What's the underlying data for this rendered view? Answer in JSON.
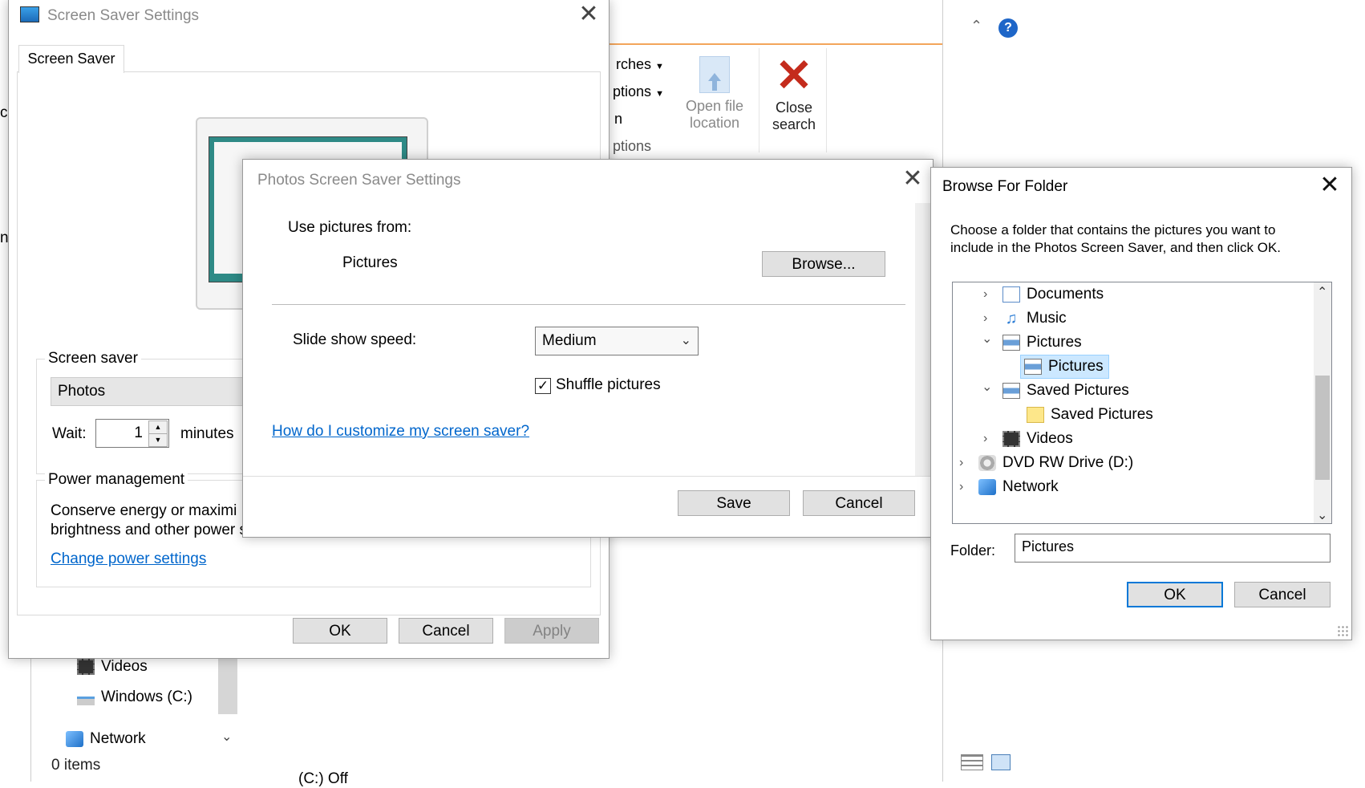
{
  "explorer": {
    "ribbon_partial_items": [
      "rches",
      "ptions",
      "n",
      "ptions"
    ],
    "open_file_location": [
      "Open file",
      "location"
    ],
    "close_search": [
      "Close",
      "search"
    ],
    "nav_items": [
      {
        "label": "Videos"
      },
      {
        "label": "Windows (C:)"
      },
      {
        "label": "Network"
      }
    ],
    "status_items": "0 items",
    "bottom_partial": "(C:)   Off"
  },
  "screensaver_dialog": {
    "title": "Screen Saver Settings",
    "tab": "Screen Saver",
    "group_screensaver_label": "Screen saver",
    "selected_saver": "Photos",
    "wait_label": "Wait:",
    "wait_value": "1",
    "minutes_label": "minutes",
    "power_group_label": "Power management",
    "power_text_line1": "Conserve energy or maximi",
    "power_text_line2": "brightness and other power settings.",
    "change_power_link": "Change power settings",
    "ok": "OK",
    "cancel": "Cancel",
    "apply": "Apply"
  },
  "photos_dialog": {
    "title": "Photos Screen Saver Settings",
    "use_pictures_label": "Use pictures from:",
    "folder_value": "Pictures",
    "browse_button": "Browse...",
    "speed_label": "Slide show speed:",
    "speed_value": "Medium",
    "shuffle_label": "Shuffle pictures",
    "shuffle_checked": true,
    "help_link": "How do I customize my screen saver?",
    "save": "Save",
    "cancel": "Cancel"
  },
  "browse_dialog": {
    "title": "Browse For Folder",
    "instructions_line1": "Choose a folder that contains the pictures you want to",
    "instructions_line2": "include in the Photos Screen Saver, and then click OK.",
    "tree": [
      {
        "label": "Documents",
        "icon": "documents-icon",
        "expander": "collapsed"
      },
      {
        "label": "Music",
        "icon": "music-icon",
        "expander": "collapsed"
      },
      {
        "label": "Pictures",
        "icon": "pictures-icon",
        "expander": "expanded"
      },
      {
        "label": "Pictures",
        "icon": "pictures-icon",
        "expander": "none",
        "selected": true
      },
      {
        "label": "Saved Pictures",
        "icon": "pictures-icon",
        "expander": "expanded"
      },
      {
        "label": "Saved Pictures",
        "icon": "folder-icon",
        "expander": "none"
      },
      {
        "label": "Videos",
        "icon": "videos-icon",
        "expander": "collapsed"
      },
      {
        "label": "DVD RW Drive (D:)",
        "icon": "dvd-drive-icon",
        "expander": "collapsed"
      },
      {
        "label": "Network",
        "icon": "network-icon",
        "expander": "collapsed"
      }
    ],
    "folder_label": "Folder:",
    "folder_value": "Pictures",
    "ok": "OK",
    "cancel": "Cancel"
  },
  "colors": {
    "accent": "#0078d7",
    "selection": "#cce8ff",
    "link": "#0066cc",
    "close_search_red": "#c42b1c",
    "help_blue": "#1e66c8"
  }
}
